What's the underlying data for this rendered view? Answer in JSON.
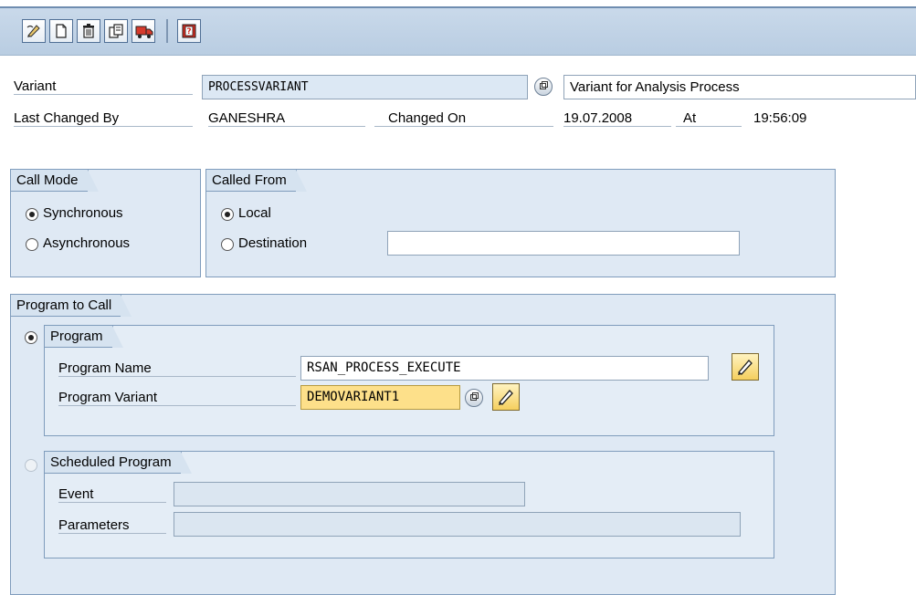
{
  "toolbar": {
    "icons": [
      "edit-icon",
      "new-icon",
      "delete-icon",
      "copy-icon",
      "transport-icon",
      "exit-icon"
    ]
  },
  "header": {
    "variant_label": "Variant",
    "variant_value": "PROCESSVARIANT",
    "variant_desc": "Variant for Analysis Process",
    "changed_by_label": "Last Changed By",
    "changed_by_value": "GANESHRA",
    "changed_on_label": "Changed On",
    "changed_on_value": "19.07.2008",
    "at_label": "At",
    "at_value": "19:56:09"
  },
  "call_mode": {
    "title": "Call Mode",
    "options": [
      "Synchronous",
      "Asynchronous"
    ],
    "selected": "Synchronous"
  },
  "called_from": {
    "title": "Called From",
    "options": [
      "Local",
      "Destination"
    ],
    "selected": "Local",
    "destination_value": ""
  },
  "program_to_call": {
    "title": "Program to Call",
    "program": {
      "title": "Program",
      "name_label": "Program Name",
      "name_value": "RSAN_PROCESS_EXECUTE",
      "variant_label": "Program Variant",
      "variant_value": "DEMOVARIANT1"
    },
    "scheduled": {
      "title": "Scheduled Program",
      "event_label": "Event",
      "event_value": "",
      "params_label": "Parameters",
      "params_value": ""
    }
  },
  "colors": {
    "toolbar": "#c4d5e8",
    "group_bg": "#dfe9f4",
    "input_focus": "#fde08a"
  }
}
